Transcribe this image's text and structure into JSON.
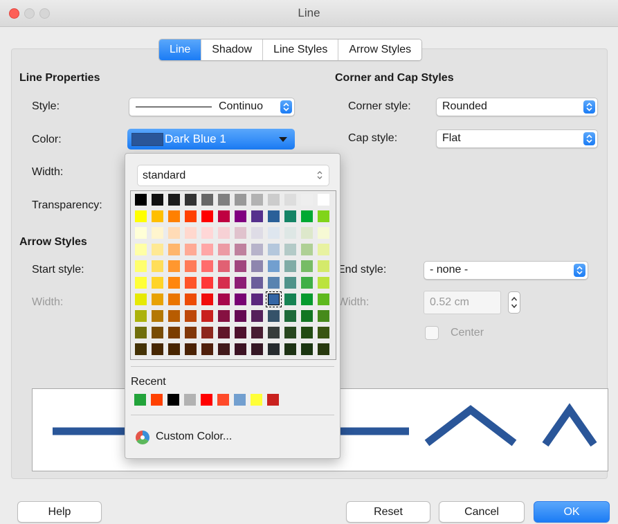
{
  "window": {
    "title": "Line"
  },
  "tabs": [
    {
      "label": "Line",
      "active": true
    },
    {
      "label": "Shadow",
      "active": false
    },
    {
      "label": "Line Styles",
      "active": false
    },
    {
      "label": "Arrow Styles",
      "active": false
    }
  ],
  "line_properties": {
    "heading": "Line Properties",
    "style_label": "Style:",
    "style_value": "Continuo",
    "color_label": "Color:",
    "color_value": "Dark Blue 1",
    "color_swatch": "#2a5699",
    "width_label": "Width:",
    "transparency_label": "Transparency:"
  },
  "corner_cap": {
    "heading": "Corner and Cap Styles",
    "corner_label": "Corner style:",
    "corner_value": "Rounded",
    "cap_label": "Cap style:",
    "cap_value": "Flat"
  },
  "arrow_styles": {
    "heading": "Arrow Styles",
    "start_label": "Start style:",
    "start_width_label": "Width:",
    "end_label": "End style:",
    "end_value": "- none -",
    "end_width_label": "Width:",
    "end_width_value": "0.52 cm",
    "center_label": "Center"
  },
  "color_dropdown": {
    "palette": "standard",
    "selected_color": "#2a5699",
    "palette_colors": [
      [
        "#000000",
        "#111111",
        "#1c1c1c",
        "#333333",
        "#666666",
        "#808080",
        "#999999",
        "#b2b2b2",
        "#cccccc",
        "#dddddd",
        "#eeeeee",
        "#ffffff"
      ],
      [
        "#ffff00",
        "#ffbf00",
        "#ff8000",
        "#ff4000",
        "#ff0000",
        "#bf0041",
        "#800080",
        "#55308d",
        "#2a6099",
        "#158466",
        "#00a933",
        "#81d41a"
      ],
      [
        "#ffffd7",
        "#fff5ce",
        "#ffdbb6",
        "#ffd8ce",
        "#ffd7d7",
        "#f7d1d5",
        "#e0c2cd",
        "#dedce6",
        "#dee6ef",
        "#dee7e5",
        "#dde8cb",
        "#f6f9d4"
      ],
      [
        "#ffffa6",
        "#ffe994",
        "#ffb66c",
        "#ffaa95",
        "#ffa6a6",
        "#ec9ba4",
        "#bf819e",
        "#b7b3ca",
        "#b4c7dc",
        "#b3cac7",
        "#afd095",
        "#e8f2a1"
      ],
      [
        "#ffff6d",
        "#ffde59",
        "#ff972f",
        "#ff7b59",
        "#ff6d6d",
        "#e16173",
        "#a1467e",
        "#8e86ae",
        "#729fcf",
        "#81aca6",
        "#77bc65",
        "#d4ea6b"
      ],
      [
        "#ffff38",
        "#ffd428",
        "#ff860d",
        "#ff5429",
        "#ff3838",
        "#d62e4e",
        "#8d1d75",
        "#6b5e9b",
        "#5983b0",
        "#50938a",
        "#3faf46",
        "#bbe33d"
      ],
      [
        "#e6e905",
        "#e8a202",
        "#ea7500",
        "#ed4c05",
        "#f10d0c",
        "#a7074b",
        "#780373",
        "#5b277d",
        "#3465a4",
        "#168253",
        "#069a2e",
        "#5eb91e"
      ],
      [
        "#acb20c",
        "#b47804",
        "#b85c00",
        "#be480a",
        "#c9211e",
        "#861141",
        "#650953",
        "#55215b",
        "#355269",
        "#1e6a39",
        "#127622",
        "#468a1a"
      ],
      [
        "#706e0c",
        "#784b04",
        "#7b3d00",
        "#813709",
        "#8d281e",
        "#611729",
        "#4e102d",
        "#481d32",
        "#383d3c",
        "#28471f",
        "#224b12",
        "#395511"
      ],
      [
        "#443205",
        "#472702",
        "#482500",
        "#4b2204",
        "#50200c",
        "#41191a",
        "#3c1223",
        "#351725",
        "#262b2f",
        "#1d3214",
        "#1a3510",
        "#27390e"
      ]
    ],
    "recent_label": "Recent",
    "recent_colors": [
      "#22a33a",
      "#ff4000",
      "#000000",
      "#b2b2b2",
      "#ff0000",
      "#ff4a2a",
      "#729fcf",
      "#ffff38",
      "#c9211e"
    ],
    "custom_label": "Custom Color..."
  },
  "buttons": {
    "help": "Help",
    "reset": "Reset",
    "cancel": "Cancel",
    "ok": "OK"
  }
}
